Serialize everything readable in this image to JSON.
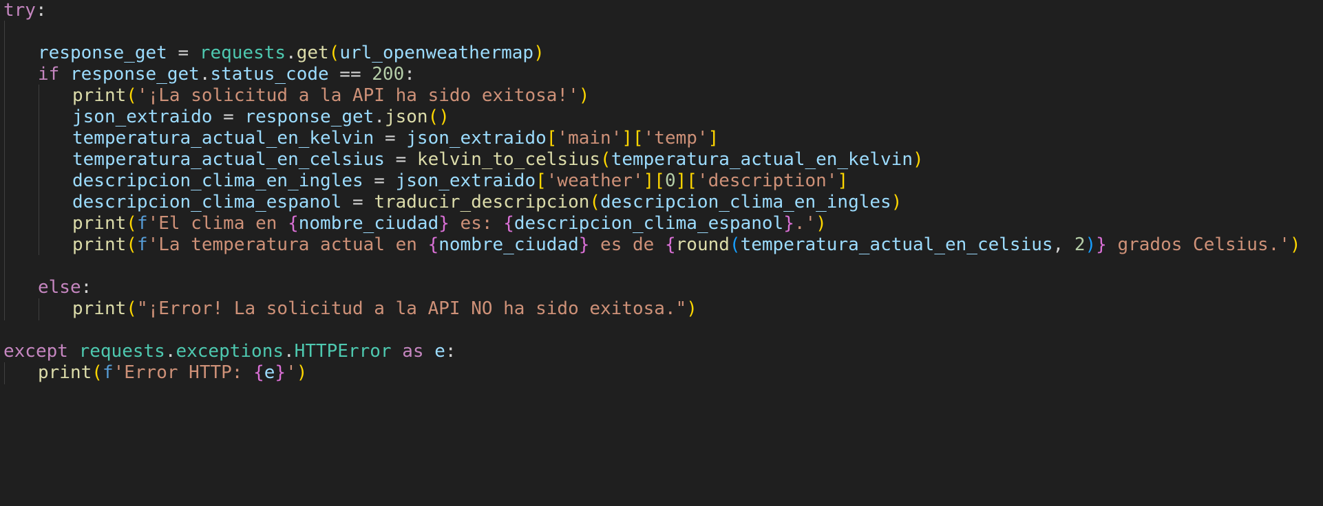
{
  "colors": {
    "background": "#1f1f1f",
    "indent_guide": "#404040",
    "keyword_control": "#c586c0",
    "keyword_storage": "#569cd6",
    "variable": "#9cdcfe",
    "function": "#dcdcaa",
    "module": "#4ec9b0",
    "string": "#ce9178",
    "number": "#b5cea8",
    "bracket_1": "#ffd700",
    "bracket_2": "#da70d6",
    "bracket_3": "#179fff",
    "punctuation": "#d4d4d4"
  },
  "code": {
    "lines": [
      {
        "indent": 0,
        "tokens": [
          {
            "t": "try",
            "c": "keyword_control"
          },
          {
            "t": ":",
            "c": "punctuation"
          }
        ]
      },
      {
        "indent": 1,
        "tokens": []
      },
      {
        "indent": 1,
        "tokens": [
          {
            "t": "response_get",
            "c": "variable"
          },
          {
            "t": " = ",
            "c": "punctuation"
          },
          {
            "t": "requests",
            "c": "module"
          },
          {
            "t": ".",
            "c": "punctuation"
          },
          {
            "t": "get",
            "c": "function"
          },
          {
            "t": "(",
            "c": "bracket_1"
          },
          {
            "t": "url_openweathermap",
            "c": "variable"
          },
          {
            "t": ")",
            "c": "bracket_1"
          }
        ]
      },
      {
        "indent": 1,
        "tokens": [
          {
            "t": "if",
            "c": "keyword_control"
          },
          {
            "t": " ",
            "c": "punctuation"
          },
          {
            "t": "response_get",
            "c": "variable"
          },
          {
            "t": ".",
            "c": "punctuation"
          },
          {
            "t": "status_code",
            "c": "variable"
          },
          {
            "t": " == ",
            "c": "punctuation"
          },
          {
            "t": "200",
            "c": "number"
          },
          {
            "t": ":",
            "c": "punctuation"
          }
        ]
      },
      {
        "indent": 2,
        "tokens": [
          {
            "t": "print",
            "c": "function"
          },
          {
            "t": "(",
            "c": "bracket_1"
          },
          {
            "t": "'¡La solicitud a la API ha sido exitosa!'",
            "c": "string"
          },
          {
            "t": ")",
            "c": "bracket_1"
          }
        ]
      },
      {
        "indent": 2,
        "tokens": [
          {
            "t": "json_extraido",
            "c": "variable"
          },
          {
            "t": " = ",
            "c": "punctuation"
          },
          {
            "t": "response_get",
            "c": "variable"
          },
          {
            "t": ".",
            "c": "punctuation"
          },
          {
            "t": "json",
            "c": "function"
          },
          {
            "t": "()",
            "c": "bracket_1"
          }
        ]
      },
      {
        "indent": 2,
        "tokens": [
          {
            "t": "temperatura_actual_en_kelvin",
            "c": "variable"
          },
          {
            "t": " = ",
            "c": "punctuation"
          },
          {
            "t": "json_extraido",
            "c": "variable"
          },
          {
            "t": "[",
            "c": "bracket_1"
          },
          {
            "t": "'main'",
            "c": "string"
          },
          {
            "t": "][",
            "c": "bracket_1"
          },
          {
            "t": "'temp'",
            "c": "string"
          },
          {
            "t": "]",
            "c": "bracket_1"
          }
        ]
      },
      {
        "indent": 2,
        "tokens": [
          {
            "t": "temperatura_actual_en_celsius",
            "c": "variable"
          },
          {
            "t": " = ",
            "c": "punctuation"
          },
          {
            "t": "kelvin_to_celsius",
            "c": "function"
          },
          {
            "t": "(",
            "c": "bracket_1"
          },
          {
            "t": "temperatura_actual_en_kelvin",
            "c": "variable"
          },
          {
            "t": ")",
            "c": "bracket_1"
          }
        ]
      },
      {
        "indent": 2,
        "tokens": [
          {
            "t": "descripcion_clima_en_ingles",
            "c": "variable"
          },
          {
            "t": " = ",
            "c": "punctuation"
          },
          {
            "t": "json_extraido",
            "c": "variable"
          },
          {
            "t": "[",
            "c": "bracket_1"
          },
          {
            "t": "'weather'",
            "c": "string"
          },
          {
            "t": "][",
            "c": "bracket_1"
          },
          {
            "t": "0",
            "c": "number"
          },
          {
            "t": "][",
            "c": "bracket_1"
          },
          {
            "t": "'description'",
            "c": "string"
          },
          {
            "t": "]",
            "c": "bracket_1"
          }
        ]
      },
      {
        "indent": 2,
        "tokens": [
          {
            "t": "descripcion_clima_espanol",
            "c": "variable"
          },
          {
            "t": " = ",
            "c": "punctuation"
          },
          {
            "t": "traducir_descripcion",
            "c": "function"
          },
          {
            "t": "(",
            "c": "bracket_1"
          },
          {
            "t": "descripcion_clima_en_ingles",
            "c": "variable"
          },
          {
            "t": ")",
            "c": "bracket_1"
          }
        ]
      },
      {
        "indent": 2,
        "tokens": [
          {
            "t": "print",
            "c": "function"
          },
          {
            "t": "(",
            "c": "bracket_1"
          },
          {
            "t": "f",
            "c": "keyword_storage"
          },
          {
            "t": "'El clima en ",
            "c": "string"
          },
          {
            "t": "{",
            "c": "bracket_2"
          },
          {
            "t": "nombre_ciudad",
            "c": "variable"
          },
          {
            "t": "}",
            "c": "bracket_2"
          },
          {
            "t": " es: ",
            "c": "string"
          },
          {
            "t": "{",
            "c": "bracket_2"
          },
          {
            "t": "descripcion_clima_espanol",
            "c": "variable"
          },
          {
            "t": "}",
            "c": "bracket_2"
          },
          {
            "t": ".'",
            "c": "string"
          },
          {
            "t": ")",
            "c": "bracket_1"
          }
        ]
      },
      {
        "indent": 2,
        "tokens": [
          {
            "t": "print",
            "c": "function"
          },
          {
            "t": "(",
            "c": "bracket_1"
          },
          {
            "t": "f",
            "c": "keyword_storage"
          },
          {
            "t": "'La temperatura actual en ",
            "c": "string"
          },
          {
            "t": "{",
            "c": "bracket_2"
          },
          {
            "t": "nombre_ciudad",
            "c": "variable"
          },
          {
            "t": "}",
            "c": "bracket_2"
          },
          {
            "t": " es de ",
            "c": "string"
          },
          {
            "t": "{",
            "c": "bracket_2"
          },
          {
            "t": "round",
            "c": "function"
          },
          {
            "t": "(",
            "c": "bracket_3"
          },
          {
            "t": "temperatura_actual_en_celsius",
            "c": "variable"
          },
          {
            "t": ", ",
            "c": "punctuation"
          },
          {
            "t": "2",
            "c": "number"
          },
          {
            "t": ")",
            "c": "bracket_3"
          },
          {
            "t": "}",
            "c": "bracket_2"
          },
          {
            "t": " grados Celsius.'",
            "c": "string"
          },
          {
            "t": ")",
            "c": "bracket_1"
          }
        ]
      },
      {
        "indent": 1,
        "tokens": []
      },
      {
        "indent": 1,
        "tokens": [
          {
            "t": "else",
            "c": "keyword_control"
          },
          {
            "t": ":",
            "c": "punctuation"
          }
        ]
      },
      {
        "indent": 2,
        "tokens": [
          {
            "t": "print",
            "c": "function"
          },
          {
            "t": "(",
            "c": "bracket_1"
          },
          {
            "t": "\"¡Error! La solicitud a la API NO ha sido exitosa.\"",
            "c": "string"
          },
          {
            "t": ")",
            "c": "bracket_1"
          }
        ]
      },
      {
        "indent": 0,
        "tokens": []
      },
      {
        "indent": 0,
        "tokens": [
          {
            "t": "except",
            "c": "keyword_control"
          },
          {
            "t": " ",
            "c": "punctuation"
          },
          {
            "t": "requests",
            "c": "module"
          },
          {
            "t": ".",
            "c": "punctuation"
          },
          {
            "t": "exceptions",
            "c": "module"
          },
          {
            "t": ".",
            "c": "punctuation"
          },
          {
            "t": "HTTPError",
            "c": "module"
          },
          {
            "t": " ",
            "c": "punctuation"
          },
          {
            "t": "as",
            "c": "keyword_control"
          },
          {
            "t": " ",
            "c": "punctuation"
          },
          {
            "t": "e",
            "c": "variable"
          },
          {
            "t": ":",
            "c": "punctuation"
          }
        ]
      },
      {
        "indent": 1,
        "tokens": [
          {
            "t": "print",
            "c": "function"
          },
          {
            "t": "(",
            "c": "bracket_1"
          },
          {
            "t": "f",
            "c": "keyword_storage"
          },
          {
            "t": "'Error HTTP: ",
            "c": "string"
          },
          {
            "t": "{",
            "c": "bracket_2"
          },
          {
            "t": "e",
            "c": "variable"
          },
          {
            "t": "}",
            "c": "bracket_2"
          },
          {
            "t": "'",
            "c": "string"
          },
          {
            "t": ")",
            "c": "bracket_1"
          }
        ]
      }
    ]
  }
}
